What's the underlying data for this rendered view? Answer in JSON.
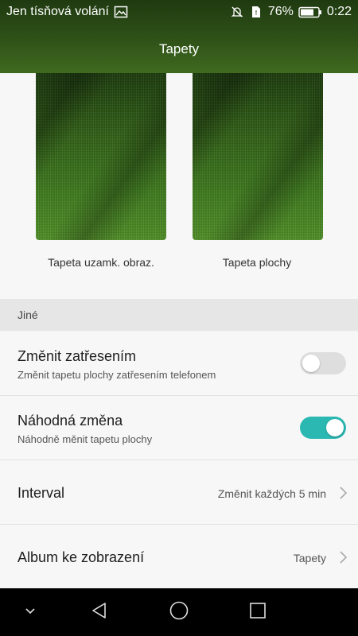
{
  "status_bar": {
    "carrier": "Jen tísňová volání",
    "battery_percent": "76%",
    "time": "0:22",
    "icons": [
      "image-icon",
      "mute-icon",
      "sim-icon",
      "battery-icon"
    ]
  },
  "title": "Tapety",
  "wallpapers": {
    "lock_label": "Tapeta uzamk. obraz.",
    "home_label": "Tapeta plochy"
  },
  "section": {
    "label": "Jiné"
  },
  "settings": {
    "shake": {
      "title": "Změnit zatřesením",
      "subtitle": "Změnit tapetu plochy zatřesením telefonem",
      "enabled": false
    },
    "random": {
      "title": "Náhodná změna",
      "subtitle": "Náhodně měnit tapetu plochy",
      "enabled": true
    },
    "interval": {
      "title": "Interval",
      "value": "Změnit každých 5 min"
    },
    "album": {
      "title": "Album ke zobrazení",
      "value": "Tapety"
    }
  },
  "colors": {
    "accent": "#2bb8b2",
    "header": "#2c4d17"
  },
  "nav": {
    "icons": [
      "chevron-down-icon",
      "back-icon",
      "home-icon",
      "recents-icon"
    ]
  }
}
